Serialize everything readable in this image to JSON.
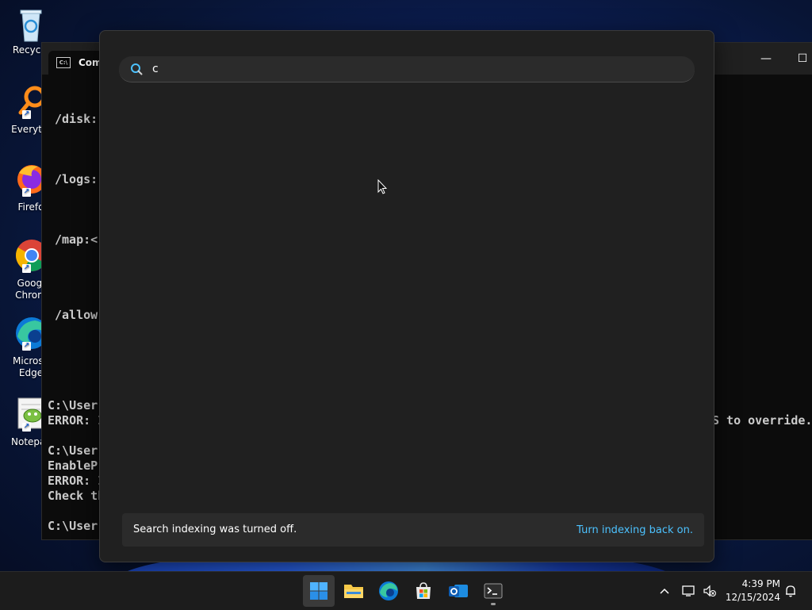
{
  "desktop": {
    "icons": [
      {
        "label": "Recycle",
        "icon": "recycle-bin-icon"
      },
      {
        "label": "Everythi",
        "icon": "everything-search-icon"
      },
      {
        "label": "Firefo",
        "icon": "firefox-icon"
      },
      {
        "label": "Googl\nChrom",
        "icon": "chrome-icon"
      },
      {
        "label": "Microso\nEdge",
        "icon": "edge-icon"
      },
      {
        "label": "Notepac",
        "icon": "notepad-plus-icon"
      }
    ]
  },
  "cmd": {
    "tab_label": "Comm",
    "minimize": "—",
    "maximize": "☐",
    "lines": [
      "/disk:",
      "/logs:",
      "/map:<",
      "/allow",
      "C:\\User",
      "ERROR: I",
      "C:\\User",
      "EnableP",
      "ERROR: I",
      "Check th",
      "C:\\User"
    ],
    "right_text": "S to override."
  },
  "search": {
    "query": "c",
    "status_message": "Search indexing was turned off.",
    "status_link": "Turn indexing back on."
  },
  "taskbar": {
    "apps": [
      {
        "name": "start",
        "icon": "windows-start-icon"
      },
      {
        "name": "file-explorer",
        "icon": "folder-icon"
      },
      {
        "name": "edge",
        "icon": "edge-icon"
      },
      {
        "name": "store",
        "icon": "microsoft-store-icon"
      },
      {
        "name": "outlook",
        "icon": "outlook-icon"
      },
      {
        "name": "terminal",
        "icon": "terminal-icon"
      }
    ],
    "time": "4:39 PM",
    "date": "12/15/2024"
  }
}
